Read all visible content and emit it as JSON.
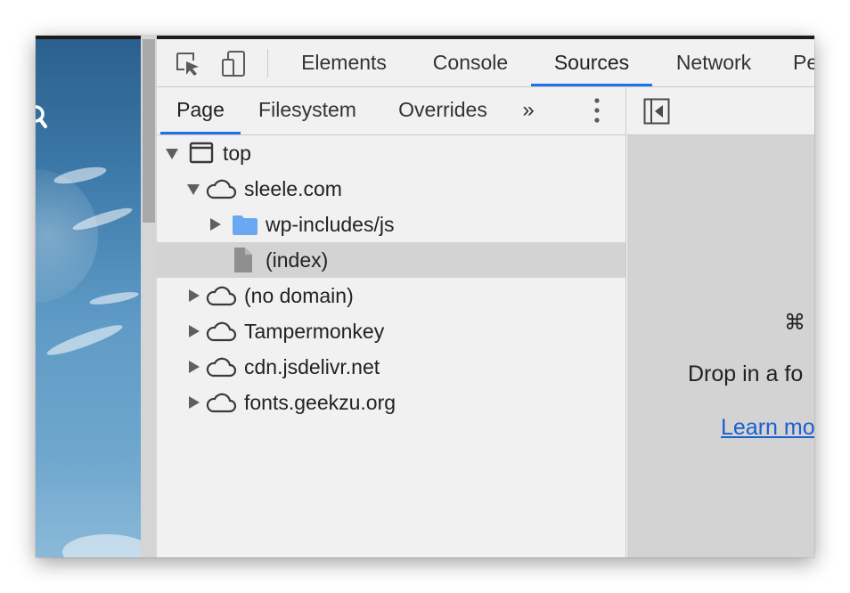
{
  "colors": {
    "accent": "#1a73e8",
    "link": "#1a5fd0",
    "selected_row": "#d3d3d3",
    "folder": "#6aa8f2",
    "file": "#8f8f8f"
  },
  "toolbar": {
    "inspect_icon": "inspect-element-icon",
    "device_icon": "device-toolbar-icon",
    "tabs": [
      {
        "label": "Elements",
        "active": false
      },
      {
        "label": "Console",
        "active": false
      },
      {
        "label": "Sources",
        "active": true
      },
      {
        "label": "Network",
        "active": false
      },
      {
        "label": "Pe",
        "active": false
      }
    ]
  },
  "navigator": {
    "tabs": [
      {
        "label": "Page",
        "active": true
      },
      {
        "label": "Filesystem",
        "active": false
      },
      {
        "label": "Overrides",
        "active": false
      }
    ],
    "more_tabs": "»",
    "tree": [
      {
        "label": "top",
        "icon": "frame-icon",
        "expanded": true
      },
      {
        "label": "sleele.com",
        "icon": "cloud-icon",
        "expanded": true
      },
      {
        "label": "wp-includes/js",
        "icon": "folder-icon",
        "expanded": false
      },
      {
        "label": "(index)",
        "icon": "file-icon",
        "selected": true
      },
      {
        "label": "(no domain)",
        "icon": "cloud-icon",
        "expanded": false
      },
      {
        "label": "Tampermonkey",
        "icon": "cloud-icon",
        "expanded": false
      },
      {
        "label": "cdn.jsdelivr.net",
        "icon": "cloud-icon",
        "expanded": false
      },
      {
        "label": "fonts.geekzu.org",
        "icon": "cloud-icon",
        "expanded": false
      }
    ]
  },
  "editor": {
    "shortcut": "⌘",
    "drop_text": "Drop in a fo",
    "link": "Learn mo"
  }
}
